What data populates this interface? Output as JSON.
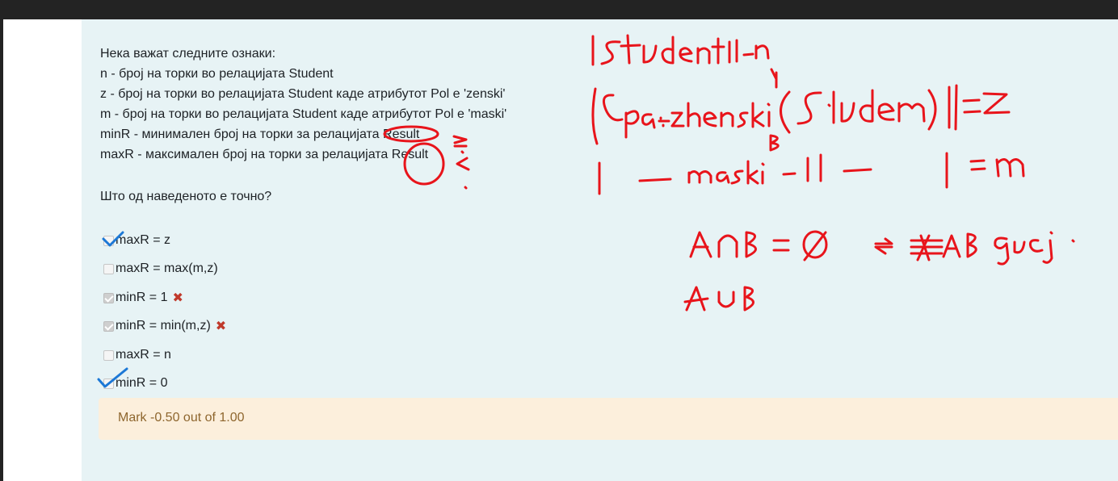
{
  "question": {
    "lines": [
      "Нека важат следните ознаки:",
      "n - број на торки во релацијата Student",
      "z - број на торки во релацијата Student каде атрибутот Pol е 'zenski'",
      "m - број на торки во релацијата Student каде атрибутот Pol е 'maski'",
      "minR - минимален број на торки за релацијата Result",
      "maxR - максимален број на торки за релацијата Result"
    ],
    "prompt": "Што од наведеното е точно?"
  },
  "answers": [
    {
      "label": "maxR = z",
      "checked": false,
      "incorrect": false
    },
    {
      "label": "maxR = max(m,z)",
      "checked": false,
      "incorrect": false
    },
    {
      "label": "minR = 1",
      "checked": true,
      "incorrect": true
    },
    {
      "label": "minR = min(m,z)",
      "checked": true,
      "incorrect": true
    },
    {
      "label": "maxR = n",
      "checked": false,
      "incorrect": false
    },
    {
      "label": "minR = 0",
      "checked": false,
      "incorrect": false
    }
  ],
  "incorrect_icon": "✖",
  "feedback": {
    "mark": "Mark -0.50 out of 1.00"
  },
  "colors": {
    "panel_background": "#e7f3f5",
    "feedback_background": "#fcefdc",
    "feedback_text": "#8e662e",
    "incorrect_mark": "#c0392b",
    "annotation_red": "#e8141b",
    "annotation_blue": "#1c78d6"
  },
  "annotations": {
    "handwritten": [
      "|Student| - n",
      "|σ pol=zhenski (Student)| = z",
      "B",
      "| — maski — || — | = m",
      "A∩B = ∅",
      "⇒ A B disj.",
      "A∪B"
    ],
    "marks": [
      "≥",
      "≤"
    ]
  }
}
